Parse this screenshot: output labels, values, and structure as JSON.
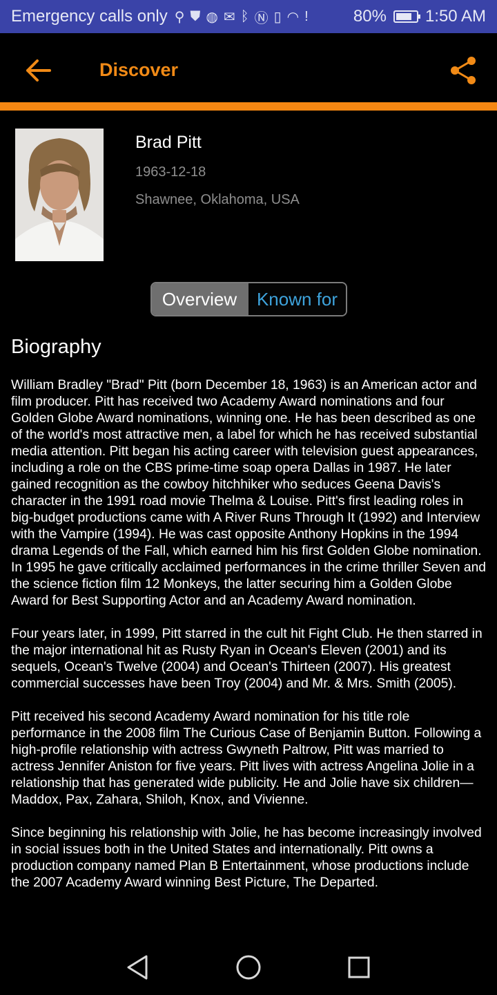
{
  "status_bar": {
    "carrier": "Emergency calls only",
    "battery_percent": "80%",
    "battery_level": 0.8,
    "time": "1:50 AM",
    "icons": [
      "usb-icon",
      "shield-icon",
      "basketball-icon",
      "mail-icon",
      "bluetooth-icon",
      "nfc-icon",
      "vibrate-icon",
      "wifi-icon",
      "alert-icon",
      "battery-icon"
    ]
  },
  "app_bar": {
    "title": "Discover",
    "accent_color": "#f58712",
    "icons": [
      "back-arrow-icon",
      "share-icon"
    ]
  },
  "person": {
    "name": "Brad Pitt",
    "birth_date": "1963-12-18",
    "birth_place": "Shawnee, Oklahoma, USA"
  },
  "tabs": {
    "overview": "Overview",
    "known_for": "Known for",
    "selected": "Overview"
  },
  "biography": {
    "heading": "Biography",
    "paragraphs": [
      "William Bradley \"Brad\" Pitt (born December 18, 1963) is an American actor and film producer. Pitt has received two Academy Award nominations and four Golden Globe Award nominations, winning one. He has been described as one of the world's most attractive men, a label for which he has received substantial media attention. Pitt began his acting career with television guest appearances, including a role on the CBS prime-time soap opera Dallas in 1987. He later gained recognition as the cowboy hitchhiker who seduces Geena Davis's character in the 1991 road movie Thelma & Louise. Pitt's first leading roles in big-budget productions came with A River Runs Through It (1992) and Interview with the Vampire (1994). He was cast opposite Anthony Hopkins in the 1994 drama Legends of the Fall, which earned him his first Golden Globe nomination. In 1995 he gave critically acclaimed performances in the crime thriller Seven and the science fiction film 12 Monkeys, the latter securing him a Golden Globe Award for Best Supporting Actor and an Academy Award nomination.",
      "Four years later, in 1999, Pitt starred in the cult hit Fight Club. He then starred in the major international hit as Rusty Ryan in Ocean's Eleven (2001) and its sequels, Ocean's Twelve (2004) and Ocean's Thirteen (2007). His greatest commercial successes have been Troy (2004) and Mr. & Mrs. Smith (2005).",
      "Pitt received his second Academy Award nomination for his title role performance in the 2008 film The Curious Case of Benjamin Button. Following a high-profile relationship with actress Gwyneth Paltrow, Pitt was married to actress Jennifer Aniston for five years. Pitt lives with actress Angelina Jolie in a relationship that has generated wide publicity. He and Jolie have six children—Maddox, Pax, Zahara, Shiloh, Knox, and Vivienne.",
      "Since beginning his relationship with Jolie, he has become increasingly involved in social issues both in the United States and internationally. Pitt owns a production company named Plan B Entertainment, whose productions include the 2007 Academy Award winning Best Picture, The Departed."
    ]
  },
  "nav_bar": {
    "icons": [
      "back-triangle-icon",
      "home-circle-icon",
      "recents-square-icon"
    ]
  }
}
